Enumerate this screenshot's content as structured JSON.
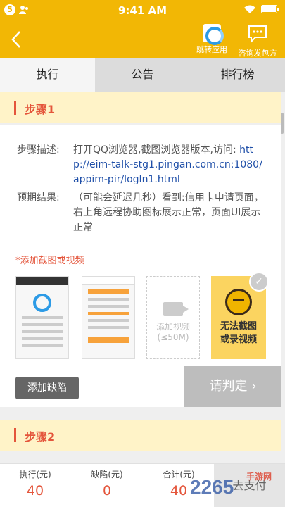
{
  "status_bar": {
    "badge": "5",
    "time": "9:41 AM"
  },
  "nav": {
    "jump_label": "跳转应用",
    "consult_label": "咨询发包方"
  },
  "tabs": [
    "执行",
    "公告",
    "排行榜"
  ],
  "step1": {
    "title": "步骤1",
    "desc_label": "步骤描述:",
    "desc_text": "打开QQ浏览器,截图浏览器版本,访问:",
    "desc_url": "http://eim-talk-stg1.pingan.com.cn:1080/appim-pir/logIn1.html",
    "expect_label": "预期结果:",
    "expect_text": "（可能会延迟几秒）看到:信用卡申请页面，右上角远程协助图标展示正常，页面UI展示正常"
  },
  "media": {
    "add_label": "*添加截图或视频",
    "add_video_line1": "添加视频",
    "add_video_line2": "(≤50M)",
    "cant_line1": "无法截图",
    "cant_line2": "或录视频"
  },
  "actions": {
    "add_defect": "添加缺陷",
    "judge": "请判定 ›"
  },
  "step2": {
    "title": "步骤2"
  },
  "bottom": {
    "exec_label": "执行(元)",
    "exec_value": "40",
    "defect_label": "缺陷(元)",
    "defect_value": "0",
    "total_label": "合计(元)",
    "total_value": "40",
    "pay_label": "去支付"
  },
  "watermark": {
    "text": "2265",
    "site": "手游网"
  },
  "colors": {
    "brand": "#f2b705",
    "accent": "#e4553b",
    "link": "#1f4fa8"
  }
}
